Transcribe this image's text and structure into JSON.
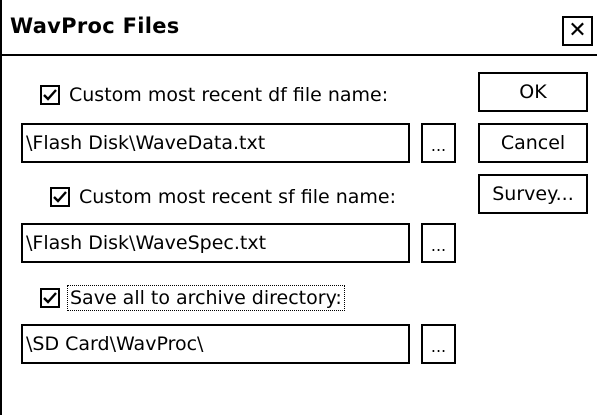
{
  "window": {
    "title": "WavProc Files",
    "close_label": "✕"
  },
  "options": {
    "df": {
      "checked": true,
      "label": "Custom most recent df file name:",
      "value": "\\Flash Disk\\WaveData.txt",
      "browse_label": "..."
    },
    "sf": {
      "checked": true,
      "label": "Custom most recent sf file name:",
      "value": "\\Flash Disk\\WaveSpec.txt",
      "browse_label": "..."
    },
    "archive": {
      "checked": true,
      "label": "Save all to archive directory:",
      "value": "\\SD Card\\WavProc\\",
      "browse_label": "..."
    }
  },
  "buttons": {
    "ok": "OK",
    "cancel": "Cancel",
    "survey": "Survey..."
  },
  "icons": {
    "checkmark": "check-icon",
    "close": "close-icon"
  }
}
